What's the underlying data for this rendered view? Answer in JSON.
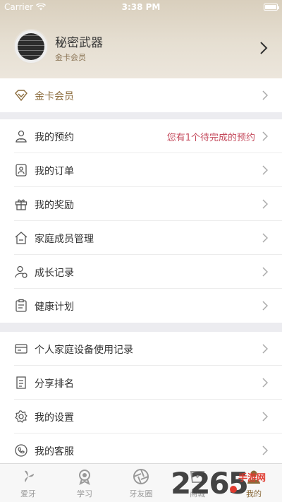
{
  "status_bar": {
    "carrier": "Carrier",
    "time": "3:38 PM"
  },
  "profile": {
    "name": "秘密武器",
    "level": "金卡会员"
  },
  "membership": {
    "label": "金卡会员"
  },
  "menu_primary": [
    {
      "label": "我的预约",
      "hint": "您有1个待完成的预约",
      "icon": "doctor-icon"
    },
    {
      "label": "我的订单",
      "hint": "",
      "icon": "order-icon"
    },
    {
      "label": "我的奖励",
      "hint": "",
      "icon": "gift-icon"
    },
    {
      "label": "家庭成员管理",
      "hint": "",
      "icon": "home-icon"
    },
    {
      "label": "成长记录",
      "hint": "",
      "icon": "growth-icon"
    },
    {
      "label": "健康计划",
      "hint": "",
      "icon": "clipboard-icon"
    }
  ],
  "menu_secondary": [
    {
      "label": "个人家庭设备使用记录",
      "icon": "device-card-icon"
    },
    {
      "label": "分享排名",
      "icon": "ranking-icon"
    },
    {
      "label": "我的设置",
      "icon": "gear-icon"
    },
    {
      "label": "我的客服",
      "icon": "phone-icon"
    }
  ],
  "tabbar": [
    {
      "label": "爱牙",
      "icon": "tooth-icon"
    },
    {
      "label": "学习",
      "icon": "study-icon"
    },
    {
      "label": "牙友圈",
      "icon": "aperture-icon"
    },
    {
      "label": "商城",
      "icon": "mall-icon"
    },
    {
      "label": "我的",
      "icon": "profile-icon"
    }
  ],
  "active_tab": "我的",
  "watermark": {
    "number": "2265",
    "text": "手游网"
  },
  "colors": {
    "accent_gold": "#8a6a3a",
    "hint_red": "#c44a5c",
    "header_bg": "#ddd3c2"
  }
}
